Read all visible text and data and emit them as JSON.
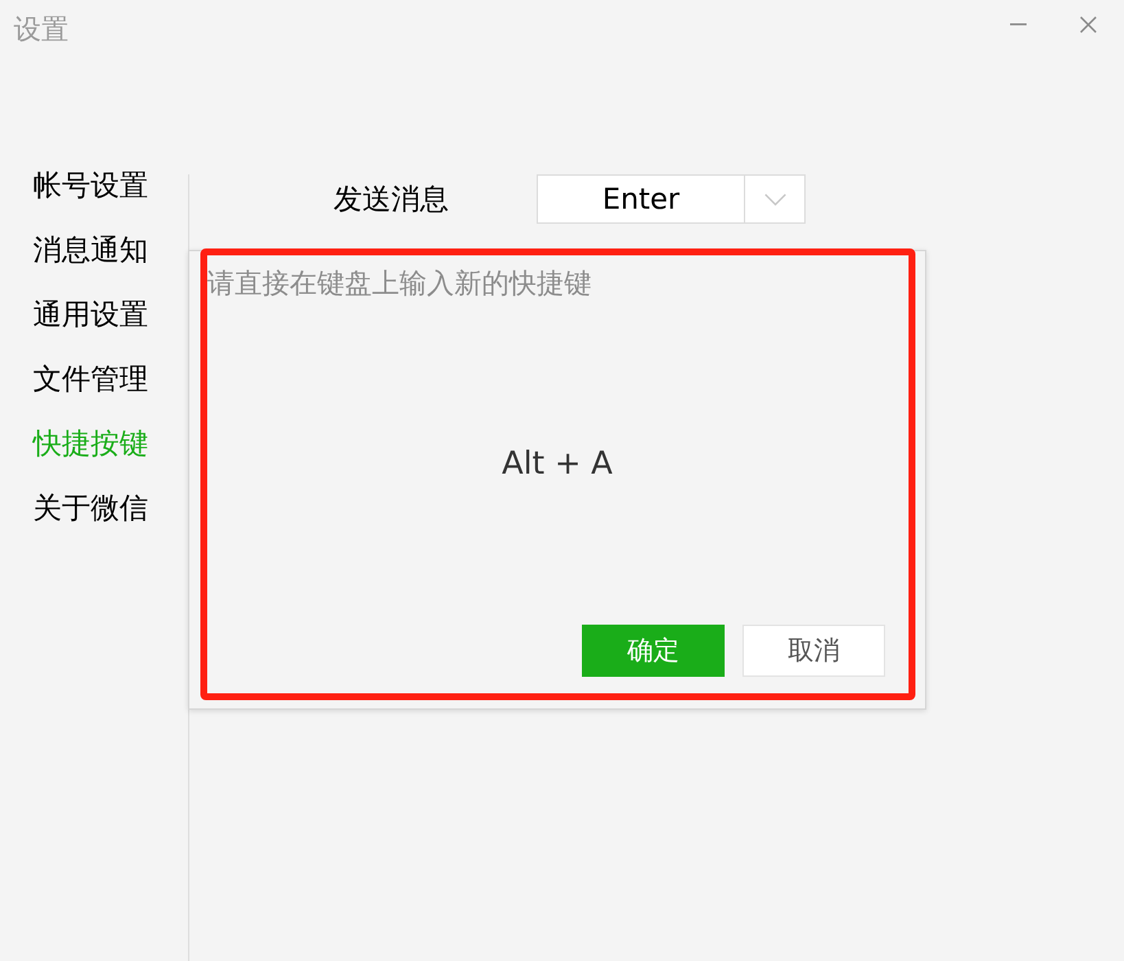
{
  "window": {
    "title": "设置"
  },
  "sidebar": {
    "items": [
      {
        "label": "帐号设置",
        "selected": false
      },
      {
        "label": "消息通知",
        "selected": false
      },
      {
        "label": "通用设置",
        "selected": false
      },
      {
        "label": "文件管理",
        "selected": false
      },
      {
        "label": "快捷按键",
        "selected": true
      },
      {
        "label": "关于微信",
        "selected": false
      }
    ]
  },
  "settings": [
    {
      "label": "发送消息",
      "value": "Enter"
    }
  ],
  "dialog": {
    "prompt": "请直接在键盘上输入新的快捷键",
    "shortcut": "Alt + A",
    "buttons": [
      {
        "label": "确定",
        "kind": "primary"
      },
      {
        "label": "取消",
        "kind": "secondary"
      }
    ]
  }
}
